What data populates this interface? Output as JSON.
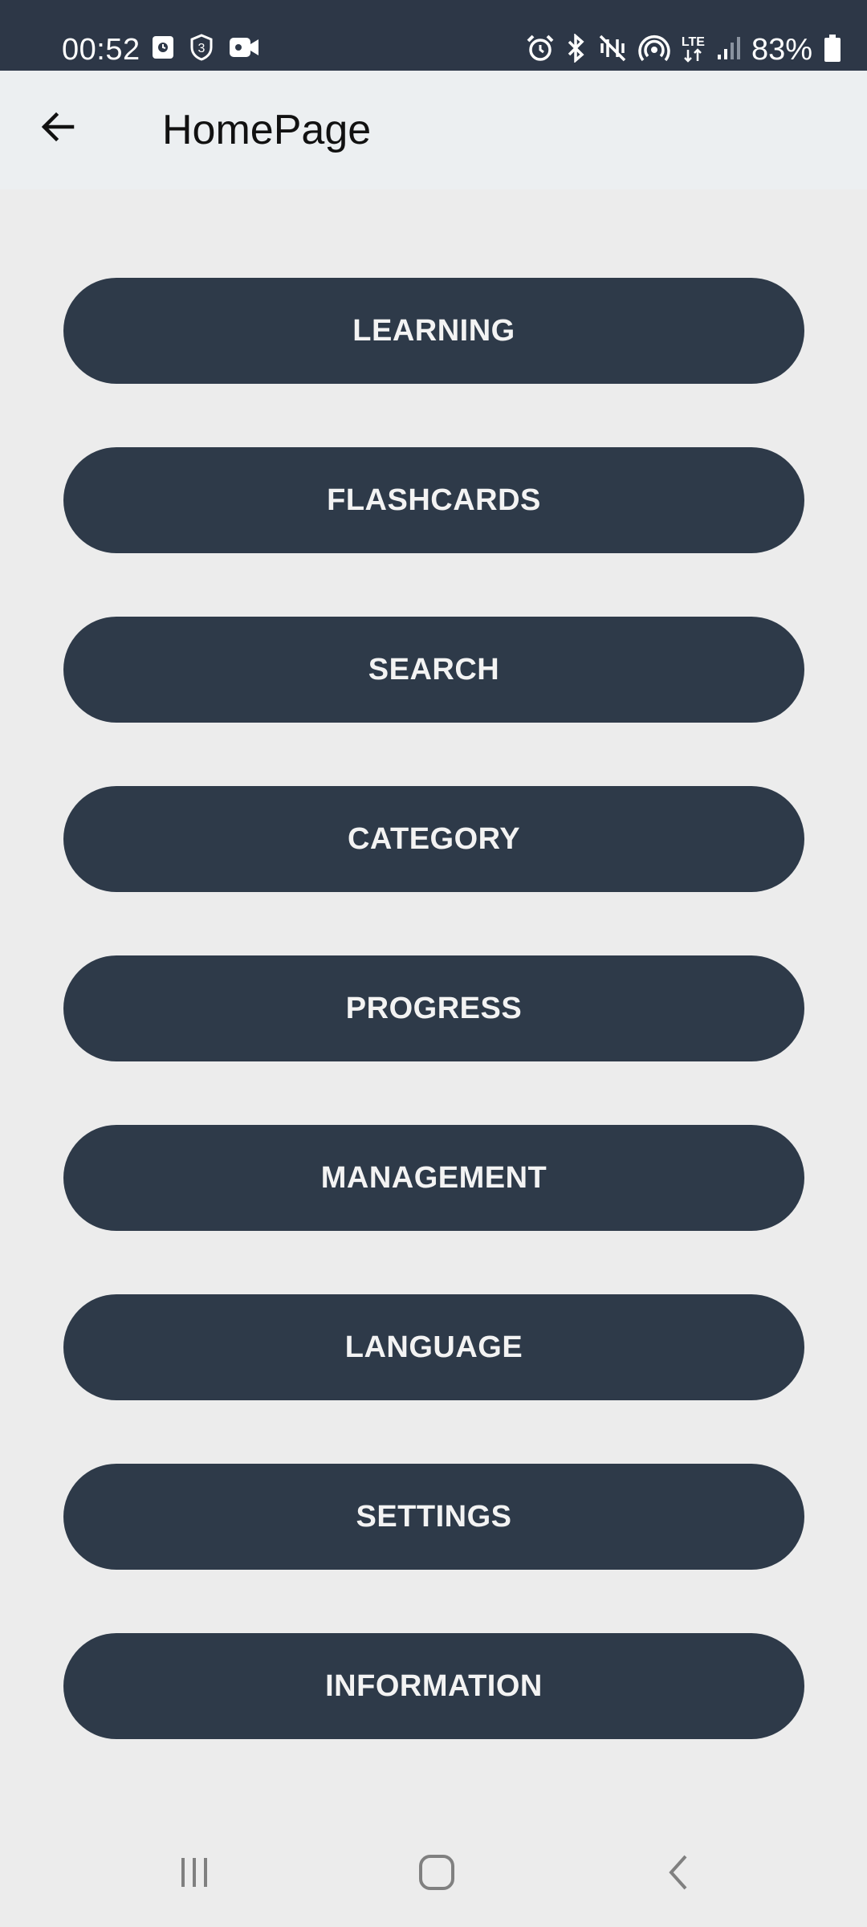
{
  "status_bar": {
    "time": "00:52",
    "battery": "83%",
    "left_icons": [
      "clock-notification-icon",
      "shield-3-icon",
      "video-camera-icon"
    ],
    "right_icons": [
      "alarm-icon",
      "bluetooth-icon",
      "vibrate-mute-icon",
      "hotspot-icon",
      "lte-icon",
      "signal-icon",
      "battery-icon"
    ],
    "lte_label": "LTE"
  },
  "app_bar": {
    "title": "HomePage",
    "back_icon": "arrow-left-icon"
  },
  "menu": {
    "items": [
      {
        "label": "LEARNING"
      },
      {
        "label": "FLASHCARDS"
      },
      {
        "label": "SEARCH"
      },
      {
        "label": "CATEGORY"
      },
      {
        "label": "PROGRESS"
      },
      {
        "label": "MANAGEMENT"
      },
      {
        "label": "LANGUAGE"
      },
      {
        "label": "SETTINGS"
      },
      {
        "label": "INFORMATION"
      }
    ]
  },
  "nav_bar": {
    "icons": [
      "recent-apps-icon",
      "home-icon",
      "back-icon"
    ]
  },
  "colors": {
    "status_bar": "#2d3747",
    "app_bar": "#eceff1",
    "background": "#ececec",
    "button": "#2e3a49",
    "button_text": "#f3f3f3"
  }
}
